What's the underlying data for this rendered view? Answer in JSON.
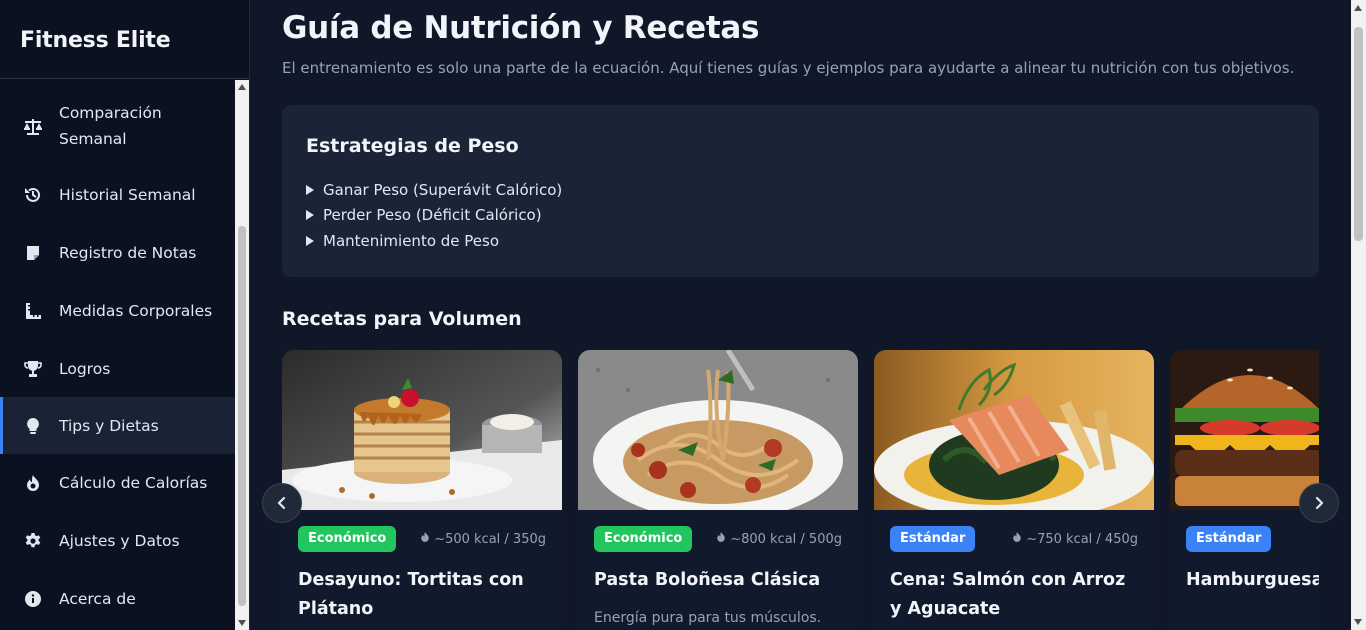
{
  "brand": "Fitness Elite",
  "sidebar": {
    "items": [
      {
        "label": "Comparación Semanal",
        "icon": "scale-icon"
      },
      {
        "label": "Historial Semanal",
        "icon": "history-icon"
      },
      {
        "label": "Registro de Notas",
        "icon": "note-icon"
      },
      {
        "label": "Medidas Corporales",
        "icon": "ruler-icon"
      },
      {
        "label": "Logros",
        "icon": "trophy-icon"
      },
      {
        "label": "Tips y Dietas",
        "icon": "lightbulb-icon",
        "active": true
      },
      {
        "label": "Cálculo de Calorías",
        "icon": "fire-icon"
      },
      {
        "label": "Ajustes y Datos",
        "icon": "gear-icon"
      },
      {
        "label": "Acerca de",
        "icon": "info-icon"
      }
    ]
  },
  "main": {
    "title": "Guía de Nutrición y Recetas",
    "subtitle": "El entrenamiento es solo una parte de la ecuación. Aquí tienes guías y ejemplos para ayudarte a alinear tu nutrición con tus objetivos.",
    "strategies": {
      "title": "Estrategias de Peso",
      "items": [
        "Ganar Peso (Superávit Calórico)",
        "Perder Peso (Déficit Calórico)",
        "Mantenimiento de Peso"
      ]
    },
    "recipes_title": "Recetas para Volumen",
    "recipes": [
      {
        "badge": "Económico",
        "badge_color": "#22c55e",
        "kcal": "~500 kcal / 350g",
        "title": "Desayuno: Tortitas con Plátano",
        "desc": ""
      },
      {
        "badge": "Económico",
        "badge_color": "#22c55e",
        "kcal": "~800 kcal / 500g",
        "title": "Pasta Boloñesa Clásica",
        "desc": "Energía pura para tus músculos. Un"
      },
      {
        "badge": "Estándar",
        "badge_color": "#3b82f6",
        "kcal": "~750 kcal / 450g",
        "title": "Cena: Salmón con Arroz y Aguacate",
        "desc": ""
      },
      {
        "badge": "Estándar",
        "badge_color": "#3b82f6",
        "kcal": "",
        "title": "Hamburguesa Con Queso",
        "desc": ""
      }
    ]
  },
  "colors": {
    "accent": "#3b82f6",
    "green": "#22c55e",
    "bg": "#0f1729",
    "sidebar": "#0b1121"
  }
}
